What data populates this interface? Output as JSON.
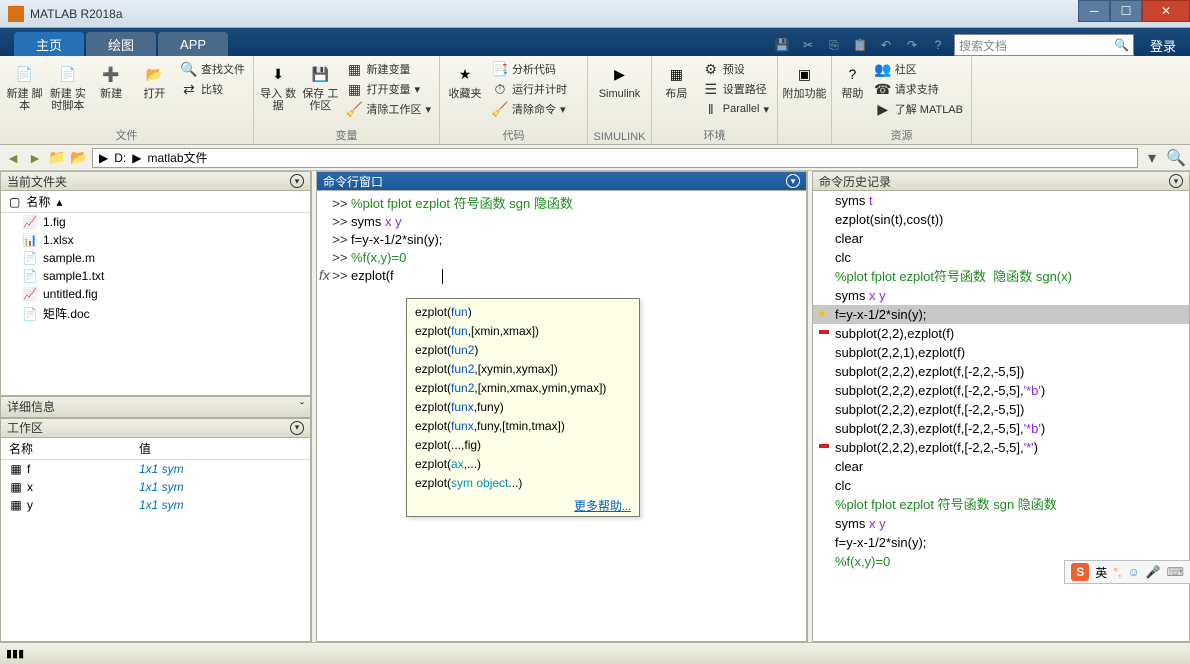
{
  "title": "MATLAB R2018a",
  "tabs": {
    "home": "主页",
    "plots": "绘图",
    "apps": "APP"
  },
  "search_placeholder": "搜索文档",
  "login": "登录",
  "ribbon": {
    "file": {
      "label": "文件",
      "new_script": "新建\n脚本",
      "new_live": "新建\n实时脚本",
      "new": "新建",
      "open": "打开",
      "find_files": "查找文件",
      "compare": "比较"
    },
    "variable": {
      "label": "变量",
      "import": "导入\n数据",
      "save_ws": "保存\n工作区",
      "new_var": "新建变量",
      "open_var": "打开变量",
      "clear_ws": "清除工作区"
    },
    "code": {
      "label": "代码",
      "favorites": "收藏夹",
      "analyze": "分析代码",
      "runtime": "运行并计时",
      "clear_cmd": "清除命令"
    },
    "simulink": {
      "label": "SIMULINK",
      "btn": "Simulink"
    },
    "env": {
      "label": "环境",
      "layout": "布局",
      "prefs": "预设",
      "setpath": "设置路径",
      "parallel": "Parallel"
    },
    "addons": {
      "btn": "附加功能"
    },
    "resources": {
      "label": "资源",
      "help": "帮助",
      "community": "社区",
      "support": "请求支持",
      "learn": "了解 MATLAB"
    }
  },
  "path": {
    "drive": "D:",
    "folder": "matlab文件"
  },
  "panels": {
    "current_folder": "当前文件夹",
    "name_col": "名称",
    "details": "详细信息",
    "workspace": "工作区",
    "ws_name": "名称",
    "ws_value": "值",
    "cmd": "命令行窗口",
    "history": "命令历史记录"
  },
  "files": [
    {
      "icon": "fig",
      "name": "1.fig"
    },
    {
      "icon": "xlsx",
      "name": "1.xlsx"
    },
    {
      "icon": "m",
      "name": "sample.m"
    },
    {
      "icon": "txt",
      "name": "sample1.txt"
    },
    {
      "icon": "fig",
      "name": "untitled.fig"
    },
    {
      "icon": "doc",
      "name": "矩阵.doc"
    }
  ],
  "workspace_vars": [
    {
      "name": "f",
      "value": "1x1 sym"
    },
    {
      "name": "x",
      "value": "1x1 sym"
    },
    {
      "name": "y",
      "value": "1x1 sym"
    }
  ],
  "cmd_lines": [
    {
      "p": ">> ",
      "t": "%plot fplot ezplot 符号函数 sgn 隐函数",
      "cls": "comment"
    },
    {
      "p": ">> ",
      "t": "syms ",
      "tail": "x y",
      "tailcls": "str"
    },
    {
      "p": ">> ",
      "t": "f=y-x-1/2*sin(y);"
    },
    {
      "p": ">> ",
      "t": "%f(x,y)=0",
      "cls": "comment"
    },
    {
      "p": ">> ",
      "t": "ezplot(f"
    }
  ],
  "hint_more": "更多帮助...",
  "hints": [
    [
      "ezplot(",
      "fun",
      ")"
    ],
    [
      "ezplot(",
      "fun",
      ",[xmin,xmax])"
    ],
    [
      "ezplot(",
      "fun2",
      ")"
    ],
    [
      "ezplot(",
      "fun2",
      ",[xymin,xymax])"
    ],
    [
      "ezplot(",
      "fun2",
      ",[xmin,xmax,ymin,ymax])"
    ],
    [
      "ezplot(",
      "funx",
      ",funy)"
    ],
    [
      "ezplot(",
      "funx",
      ",funy,[tmin,tmax])"
    ],
    [
      "ezplot(...,fig)"
    ],
    [
      "ezplot(",
      "ax",
      ",...)"
    ],
    [
      "ezplot(",
      "sym object",
      "...)"
    ]
  ],
  "history": [
    {
      "t": "syms ",
      "tail": "t",
      "tailcls": "str"
    },
    {
      "t": "ezplot(sin(t),cos(t))"
    },
    {
      "t": "clear"
    },
    {
      "t": "clc"
    },
    {
      "t": "%plot fplot ezplot符号函数  隐函数 sgn(x)",
      "cls": "comment"
    },
    {
      "t": "syms ",
      "tail": "x y",
      "tailcls": "str"
    },
    {
      "t": "f=y-x-1/2*sin(y);",
      "hl": true,
      "star": true
    },
    {
      "t": "subplot(2,2),ezplot(f)",
      "mark": true
    },
    {
      "t": "subplot(2,2,1),ezplot(f)"
    },
    {
      "t": "subplot(2,2,2),ezplot(f,[-2,2,-5,5])"
    },
    {
      "t": "subplot(2,2,2),ezplot(f,[-2,2,-5,5],",
      "tail": "'*b'",
      "tailcls": "str",
      "post": ")"
    },
    {
      "t": "subplot(2,2,2),ezplot(f,[-2,2,-5,5])"
    },
    {
      "t": "subplot(2,2,3),ezplot(f,[-2,2,-5,5],",
      "tail": "'*b'",
      "tailcls": "str",
      "post": ")"
    },
    {
      "t": "subplot(2,2,2),ezplot(f,[-2,2,-5,5],",
      "tail": "'*'",
      "tailcls": "str",
      "post": ")",
      "mark": true
    },
    {
      "t": "clear"
    },
    {
      "t": "clc"
    },
    {
      "t": "%plot fplot ezplot 符号函数 sgn 隐函数",
      "cls": "comment"
    },
    {
      "t": "syms ",
      "tail": "x y",
      "tailcls": "str"
    },
    {
      "t": "f=y-x-1/2*sin(y);"
    },
    {
      "t": "%f(x,y)=0",
      "cls": "comment"
    }
  ],
  "ime": "英"
}
